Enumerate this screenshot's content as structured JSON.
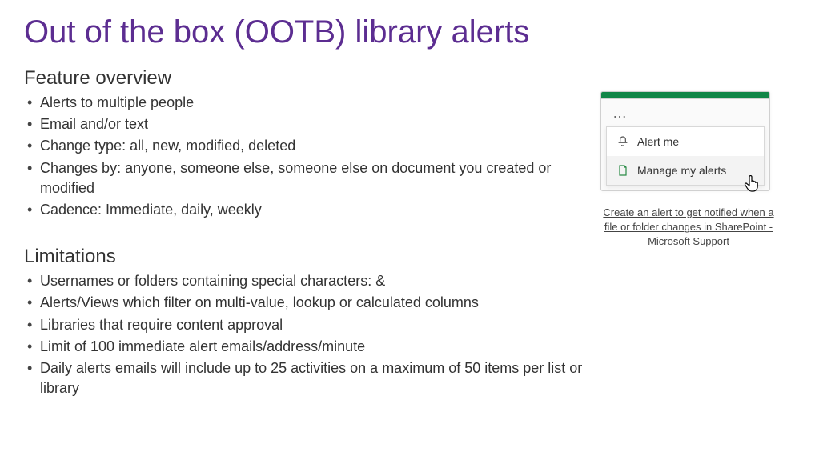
{
  "title": "Out of the box (OOTB) library alerts",
  "sections": {
    "overview": {
      "heading": "Feature overview",
      "items": [
        "Alerts to multiple people",
        "Email and/or text",
        "Change type: all, new, modified, deleted",
        "Changes by: anyone, someone else, someone else on document you created or modified",
        "Cadence: Immediate, daily, weekly"
      ]
    },
    "limitations": {
      "heading": "Limitations",
      "items": [
        "Usernames or folders containing special characters: &",
        "Alerts/Views which filter on multi-value, lookup or calculated columns",
        "Libraries that require content approval",
        "Limit of 100 immediate alert emails/address/minute",
        "Daily alerts emails will include up to 25 activities on a maximum of 50 items per list or library"
      ]
    }
  },
  "menu": {
    "ellipsis": "…",
    "alert_me_label": "Alert me",
    "manage_label": "Manage my alerts"
  },
  "link_caption": "Create an alert to get notified when a file or folder changes in SharePoint - Microsoft Support"
}
